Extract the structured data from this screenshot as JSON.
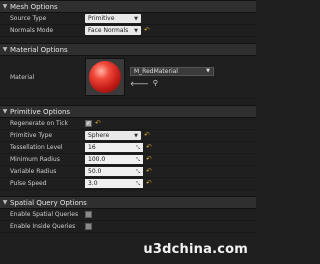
{
  "mesh_options": {
    "header": "Mesh Options",
    "source_type": {
      "label": "Source Type",
      "value": "Primitive"
    },
    "normals_mode": {
      "label": "Normals Mode",
      "value": "Face Normals"
    }
  },
  "material_options": {
    "header": "Material Options",
    "material": {
      "label": "Material",
      "value": "M_RedMaterial"
    }
  },
  "primitive_options": {
    "header": "Primitive Options",
    "regenerate_on_tick": {
      "label": "Regenerate on Tick",
      "checked": true
    },
    "primitive_type": {
      "label": "Primitive Type",
      "value": "Sphere"
    },
    "tessellation_level": {
      "label": "Tessellation Level",
      "value": "16"
    },
    "minimum_radius": {
      "label": "Minimum Radius",
      "value": "100.0"
    },
    "variable_radius": {
      "label": "Variable Radius",
      "value": "50.0"
    },
    "pulse_speed": {
      "label": "Pulse Speed",
      "value": "3.0"
    }
  },
  "spatial_query_options": {
    "header": "Spatial Query Options",
    "enable_spatial_queries": {
      "label": "Enable Spatial Queries",
      "checked": false
    },
    "enable_inside_queries": {
      "label": "Enable Inside Queries",
      "checked": false
    }
  },
  "icons": {
    "caret": "triangle-down",
    "reset": "reset-arrow",
    "material_use": "arrow-left",
    "material_browse": "search"
  },
  "colors": {
    "background": "#1f1f1f",
    "header_bg": "#2f2f2f",
    "reset_accent": "#c9a63a"
  },
  "watermark": "u3dchina.com"
}
